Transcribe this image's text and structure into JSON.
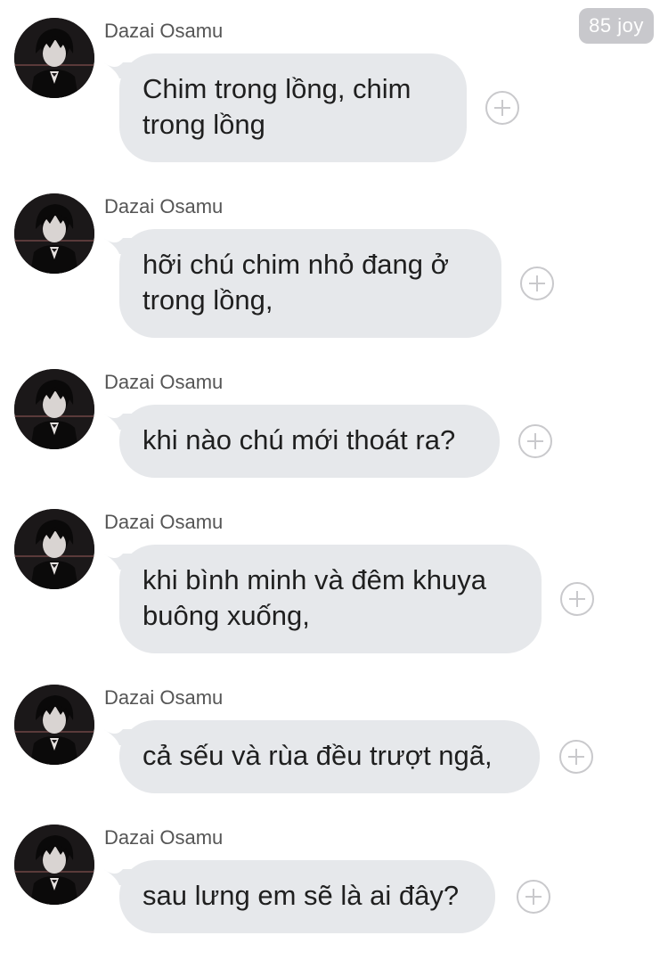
{
  "header": {
    "joy_count": "85 joy"
  },
  "messages": [
    {
      "sender": "Dazai Osamu",
      "text": "Chim trong lồng, chim trong lồng"
    },
    {
      "sender": "Dazai Osamu",
      "text": "hỡi chú chim nhỏ đang ở trong lồng,"
    },
    {
      "sender": "Dazai Osamu",
      "text": "khi nào chú mới thoát ra?"
    },
    {
      "sender": "Dazai Osamu",
      "text": "khi bình minh và đêm khuya buông xuống,"
    },
    {
      "sender": "Dazai Osamu",
      "text": "cả sếu và rùa đều trượt ngã,"
    },
    {
      "sender": "Dazai Osamu",
      "text": "sau lưng em sẽ là ai đây?"
    }
  ],
  "icons": {
    "avatar": "avatar-dark-figure",
    "react": "plus-circle-icon"
  },
  "colors": {
    "bubble": "#e6e8eb",
    "badge": "#c8c8cc",
    "sender": "#555555"
  }
}
